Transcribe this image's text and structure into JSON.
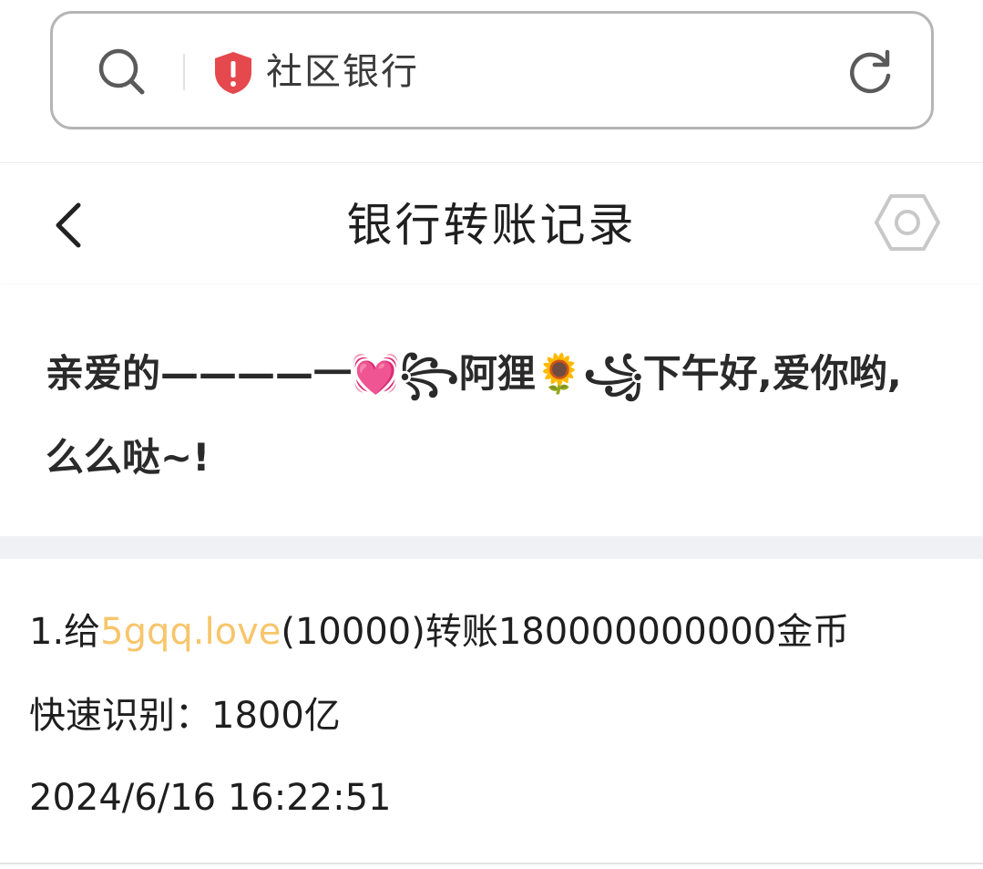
{
  "search": {
    "site_name": "社区银行"
  },
  "header": {
    "title": "银行转账记录"
  },
  "greeting": {
    "text": "亲爱的————一💓꧂阿狸🌻꧁下午好,爱你哟,么么哒~!"
  },
  "record": {
    "line1_prefix": "1.给",
    "line1_link": "5gqq.love",
    "line1_suffix": "(10000)转账180000000000金币",
    "line2": "快速识别：1800亿",
    "line3": "2024/6/16 16:22:51"
  },
  "colors": {
    "shield": "#e5484d",
    "link": "#f7c56b",
    "section_gap": "#f0f1f5"
  },
  "icons": [
    "search-icon",
    "shield-icon",
    "refresh-icon",
    "back-icon",
    "settings-icon"
  ]
}
